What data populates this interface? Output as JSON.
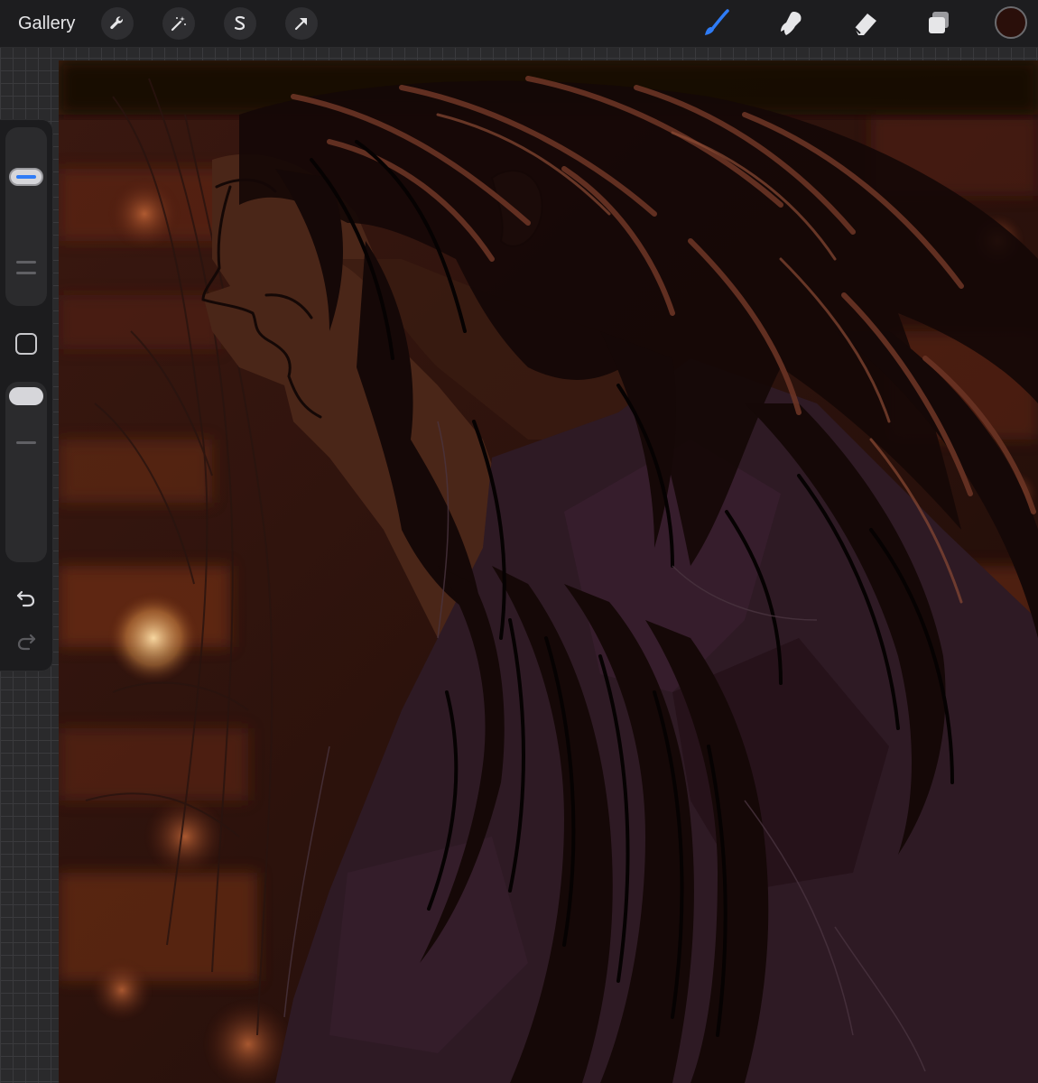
{
  "topbar": {
    "gallery_label": "Gallery",
    "left_tools": [
      {
        "name": "actions-wrench-icon"
      },
      {
        "name": "adjustments-magic-wand-icon"
      },
      {
        "name": "selection-s-icon"
      },
      {
        "name": "transform-arrow-icon"
      }
    ],
    "right_tools": [
      {
        "name": "brush-icon",
        "active": true
      },
      {
        "name": "smudge-icon",
        "active": false
      },
      {
        "name": "eraser-icon",
        "active": false
      },
      {
        "name": "layers-icon",
        "active": false
      }
    ],
    "current_color": "#2a0f0a"
  },
  "sidebar": {
    "brush_size_level": 0.75,
    "opacity_level": 1.0
  },
  "colors": {
    "accent": "#2f7cf6",
    "toolbar_bg": "#1d1d1f",
    "icon": "#e6e6e8"
  }
}
